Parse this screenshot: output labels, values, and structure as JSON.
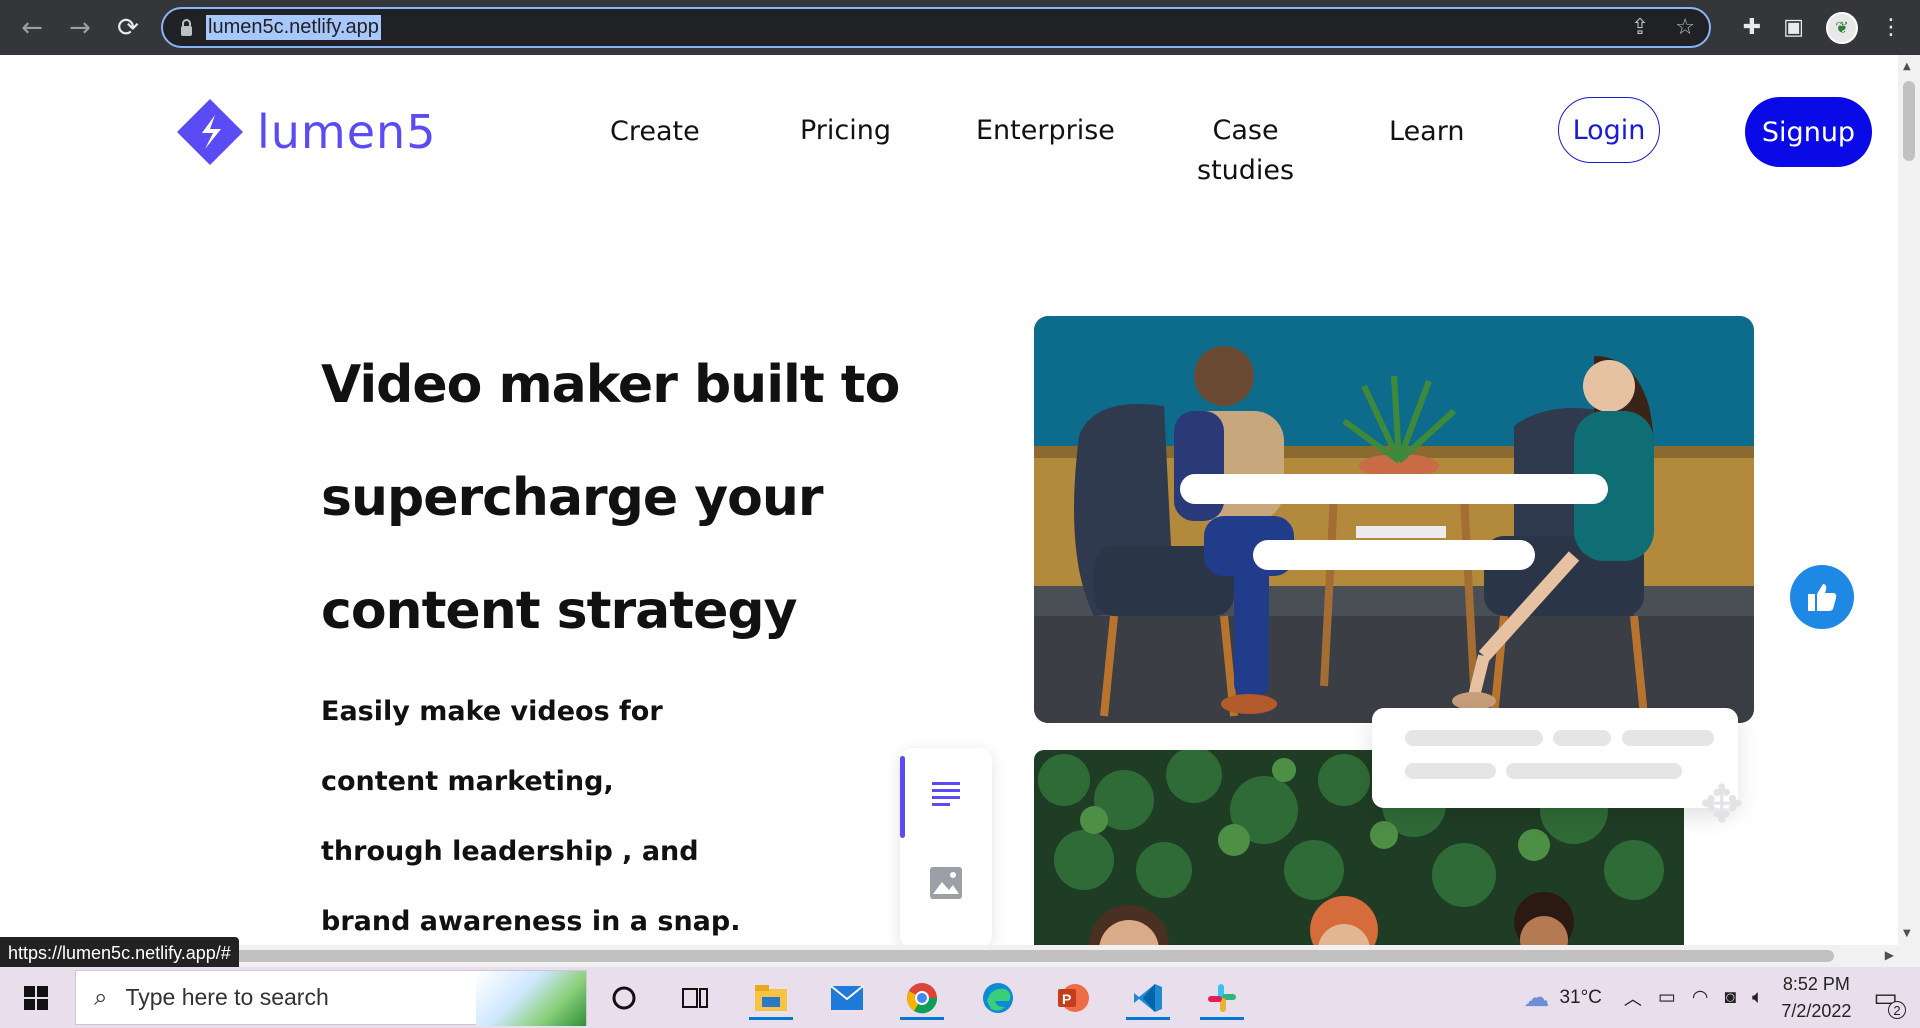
{
  "browser": {
    "url": "lumen5c.netlify.app",
    "back_icon": "←",
    "forward_icon": "→",
    "reload_icon": "⟳",
    "status_url": "https://lumen5c.netlify.app/#"
  },
  "site": {
    "logo_text": "lumen5",
    "brand_color": "#5b4bf5",
    "nav": {
      "create": "Create",
      "pricing": "Pricing",
      "enterprise": "Enterprise",
      "case_line1": "Case",
      "case_line2": "studies",
      "learn": "Learn"
    },
    "login": "Login",
    "signup": "Signup"
  },
  "hero": {
    "title_lines": [
      "Video maker built to",
      "supercharge your",
      "content strategy"
    ],
    "sub_lines": [
      "Easily make videos for",
      "content marketing,",
      "through leadership , and",
      "brand awareness in a snap."
    ]
  },
  "taskbar": {
    "search_placeholder": "Type here to search",
    "temperature": "31°C",
    "time": "8:52 PM",
    "date": "7/2/2022",
    "notification_count": "2"
  }
}
